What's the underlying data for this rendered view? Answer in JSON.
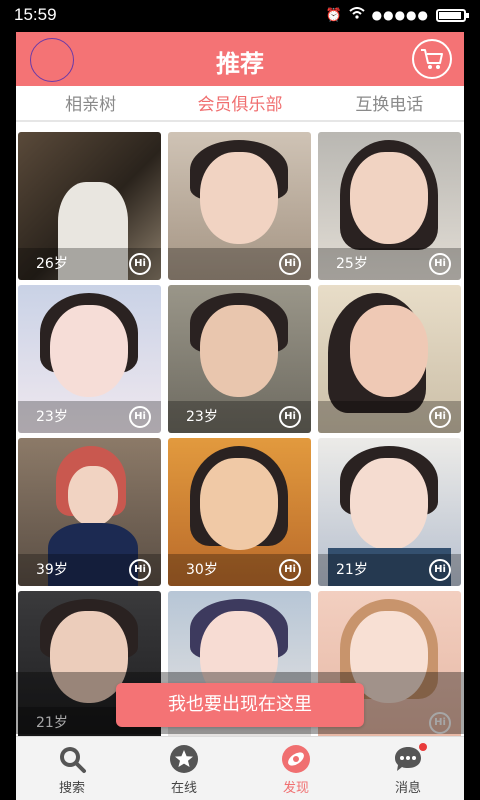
{
  "status_bar": {
    "time": "15:59"
  },
  "header": {
    "title": "推荐"
  },
  "tabs": [
    {
      "label": "相亲树",
      "active": false
    },
    {
      "label": "会员俱乐部",
      "active": true
    },
    {
      "label": "互换电话",
      "active": false
    }
  ],
  "cards": [
    {
      "age": "26岁",
      "hi": "Hi"
    },
    {
      "age": "",
      "hi": "Hi"
    },
    {
      "age": "25岁",
      "hi": "Hi"
    },
    {
      "age": "23岁",
      "hi": "Hi"
    },
    {
      "age": "23岁",
      "hi": "Hi"
    },
    {
      "age": "",
      "hi": "Hi"
    },
    {
      "age": "39岁",
      "hi": "Hi"
    },
    {
      "age": "30岁",
      "hi": "Hi"
    },
    {
      "age": "21岁",
      "hi": "Hi"
    },
    {
      "age": "21岁",
      "hi": ""
    },
    {
      "age": "",
      "hi": ""
    },
    {
      "age": "",
      "hi": "Hi"
    }
  ],
  "cta": {
    "label": "我也要出现在这里"
  },
  "bottom_nav": [
    {
      "label": "搜索",
      "icon": "search-icon",
      "active": false
    },
    {
      "label": "在线",
      "icon": "star-icon",
      "active": false
    },
    {
      "label": "发现",
      "icon": "discover-icon",
      "active": true
    },
    {
      "label": "消息",
      "icon": "message-icon",
      "active": false,
      "badge": true
    }
  ],
  "colors": {
    "accent": "#f47375",
    "active_text": "#f06f70"
  }
}
